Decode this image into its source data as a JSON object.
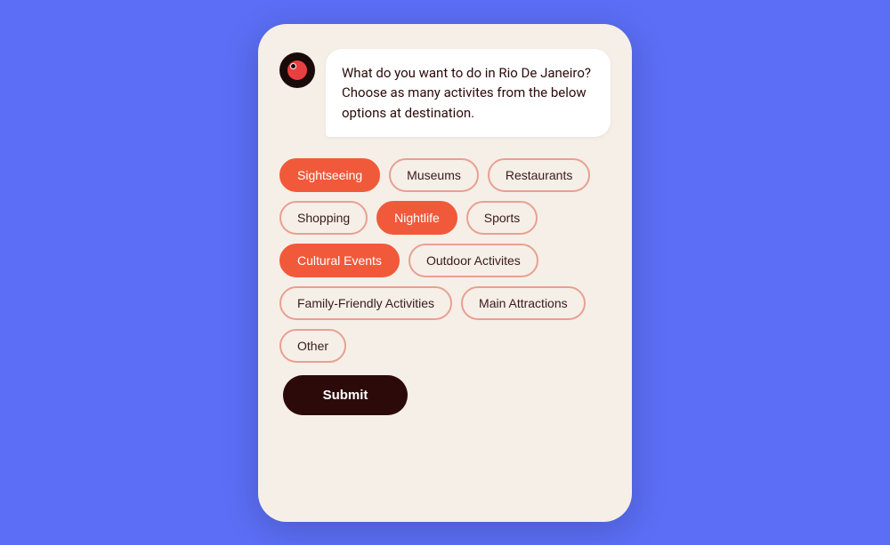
{
  "background_color": "#5B6EF5",
  "phone": {
    "background_color": "#F5EFE8"
  },
  "message": {
    "text": "What do you want to do in Rio De Janeiro? Choose as many activites from the below options at destination."
  },
  "tags": [
    {
      "id": "sightseeing",
      "label": "Sightseeing",
      "selected": true
    },
    {
      "id": "museums",
      "label": "Museums",
      "selected": false
    },
    {
      "id": "restaurants",
      "label": "Restaurants",
      "selected": false
    },
    {
      "id": "shopping",
      "label": "Shopping",
      "selected": false
    },
    {
      "id": "nightlife",
      "label": "Nightlife",
      "selected": true
    },
    {
      "id": "sports",
      "label": "Sports",
      "selected": false
    },
    {
      "id": "cultural-events",
      "label": "Cultural Events",
      "selected": true
    },
    {
      "id": "outdoor-activites",
      "label": "Outdoor Activites",
      "selected": false
    },
    {
      "id": "family-friendly",
      "label": "Family-Friendly Activities",
      "selected": false
    },
    {
      "id": "main-attractions",
      "label": "Main Attractions",
      "selected": false
    },
    {
      "id": "other",
      "label": "Other",
      "selected": false
    }
  ],
  "submit_label": "Submit"
}
